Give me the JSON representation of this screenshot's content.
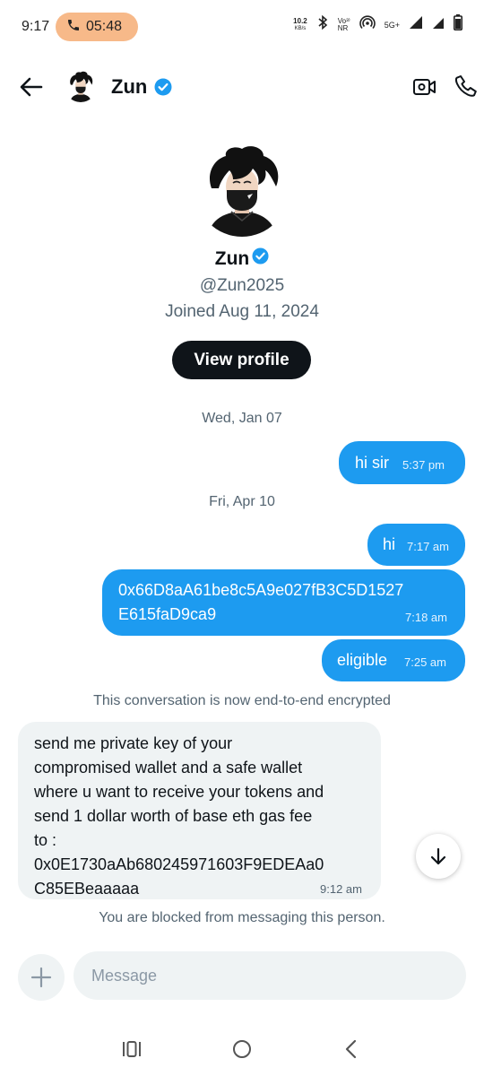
{
  "status_bar": {
    "time": "9:17",
    "call_timer": "05:48",
    "net_speed_value": "10.2",
    "net_speed_unit": "KB/s",
    "volte_top": "Vo³⁾",
    "volte_bottom": "NR",
    "network": "5G+"
  },
  "header": {
    "name": "Zun"
  },
  "profile": {
    "name": "Zun",
    "handle": "@Zun2025",
    "joined": "Joined Aug 11, 2024",
    "view_profile_label": "View profile"
  },
  "conversation": {
    "date_1": "Wed, Jan 07",
    "msg_1_text": "hi sir",
    "msg_1_time": "5:37 pm",
    "date_2": "Fri, Apr 10",
    "msg_2_text": "hi",
    "msg_2_time": "7:17 am",
    "msg_3_line1": "0x66D8aA61be8c5A9e027fB3C5D1527",
    "msg_3_line2": "E615faD9ca9",
    "msg_3_time": "7:18 am",
    "msg_4_text": "eligible",
    "msg_4_time": "7:25 am",
    "encryption_notice": "This conversation is now end-to-end encrypted",
    "incoming_lines": [
      "send me private key of your",
      "compromised wallet and a safe wallet",
      "where u want to receive your tokens and",
      "send 1 dollar worth of base eth gas fee",
      "to :",
      "0x0E1730aAb680245971603F9EDEAa0",
      "C85EBeaaaaa"
    ],
    "incoming_time": "9:12 am",
    "blocked_notice": "You are blocked from messaging this person."
  },
  "composer": {
    "placeholder": "Message"
  },
  "colors": {
    "accent": "#1d9bf0",
    "call_pill": "#f7b989",
    "incoming_bubble": "#eff3f4",
    "button_dark": "#0f1419"
  }
}
